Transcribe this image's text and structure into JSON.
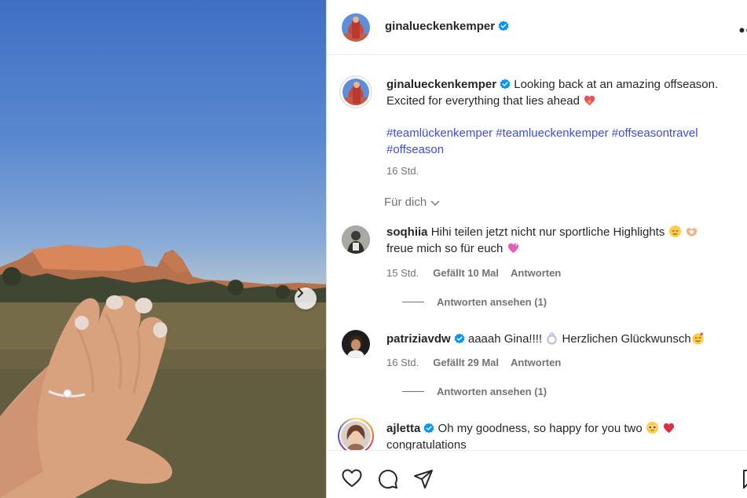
{
  "post": {
    "author": "ginalueckenkemper",
    "caption_text": "Looking back at an amazing offseason. Excited for everything that lies ahead",
    "hashtags_line1": "#teamlückenkemper #teamlueckenkemper #offseasontravel",
    "hashtags_line2": "#offseason",
    "time": "16 Std.",
    "for_you_label": "Für dich"
  },
  "comments": [
    {
      "user": "soqhiia",
      "verified": false,
      "text_line1": "Hihi teilen jetzt nicht nur sportliche Highlights",
      "text_line2": "freue mich so für euch",
      "time": "15 Std.",
      "likes": "Gefällt 10 Mal",
      "reply": "Antworten",
      "view_replies": "Antworten ansehen (1)"
    },
    {
      "user": "patriziavdw",
      "verified": true,
      "text_line1": "aaaah Gina!!!!",
      "text_line1b": "Herzlichen Glückwunsch",
      "time": "16 Std.",
      "likes": "Gefällt 29 Mal",
      "reply": "Antworten",
      "view_replies": "Antworten ansehen (1)"
    },
    {
      "user": "ajletta",
      "verified": true,
      "text_line1": "Oh my goodness, so happy for you two",
      "text_line2": "congratulations"
    }
  ],
  "icons": {
    "like": "heart-icon",
    "comment": "comment-icon",
    "share": "share-icon",
    "save": "bookmark-icon",
    "verified": "verified-badge-icon",
    "next": "chevron-right-icon",
    "more": "more-options-icon"
  },
  "colors": {
    "hashtag": "#3b4ee0",
    "verified": "#0095f6",
    "muted": "#737373"
  }
}
